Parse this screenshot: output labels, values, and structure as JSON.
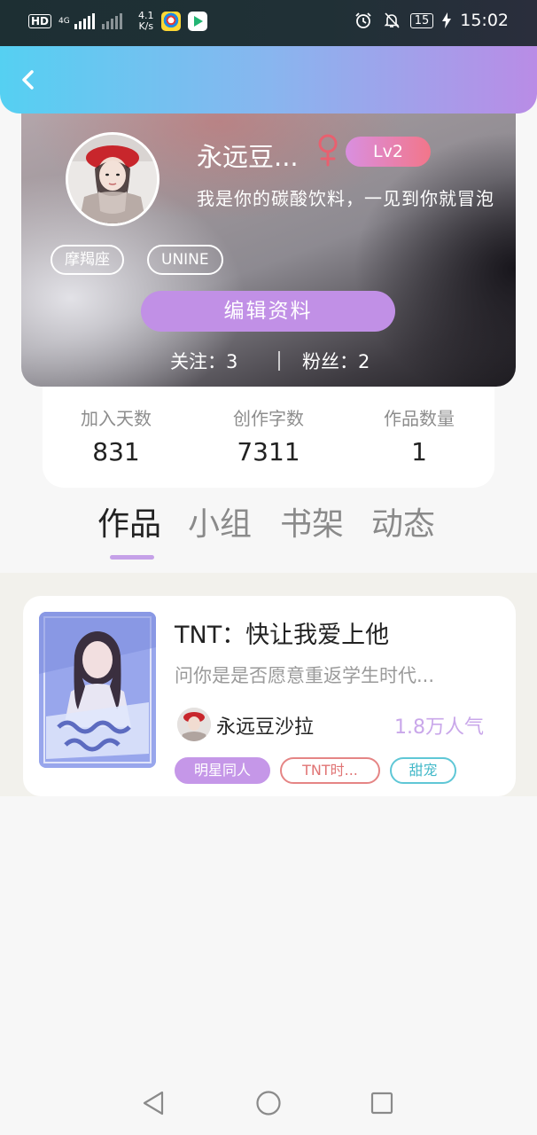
{
  "status_bar": {
    "hd": "HD",
    "net": "4G",
    "speed": "4.1\nK/s",
    "battery": "15",
    "time": "15:02",
    "icons": [
      "alarm-icon",
      "mute-icon",
      "charging-icon"
    ]
  },
  "header": {
    "back_icon": "chevron-left-icon"
  },
  "profile": {
    "username": "永远豆...",
    "gender_icon": "female-icon",
    "gender_color": "#e8606f",
    "level": "Lv2",
    "bio": "我是你的碳酸饮料，一见到你就冒泡",
    "tags": [
      "摩羯座",
      "UNINE"
    ],
    "edit_label": "编辑资料",
    "following": "关注：3",
    "followers": "粉丝：2"
  },
  "stats": [
    {
      "label": "加入天数",
      "value": "831"
    },
    {
      "label": "创作字数",
      "value": "7311"
    },
    {
      "label": "作品数量",
      "value": "1"
    }
  ],
  "tabs": [
    {
      "label": "作品",
      "active": true
    },
    {
      "label": "小组",
      "active": false
    },
    {
      "label": "书架",
      "active": false
    },
    {
      "label": "动态",
      "active": false
    }
  ],
  "works": [
    {
      "title": "TNT：快让我爱上他",
      "summary": "问你是是否愿意重返学生时代...",
      "author": "永远豆沙拉",
      "popularity": "1.8万人气",
      "tags": [
        "明星同人",
        "TNT时...",
        "甜宠"
      ]
    }
  ],
  "colors": {
    "accent": "#c190e6",
    "header_start": "#55d0f2",
    "header_end": "#b98ce6",
    "popularity": "#c9a7ea"
  },
  "nav_bar": [
    "back-triangle-icon",
    "home-circle-icon",
    "recent-square-icon"
  ]
}
